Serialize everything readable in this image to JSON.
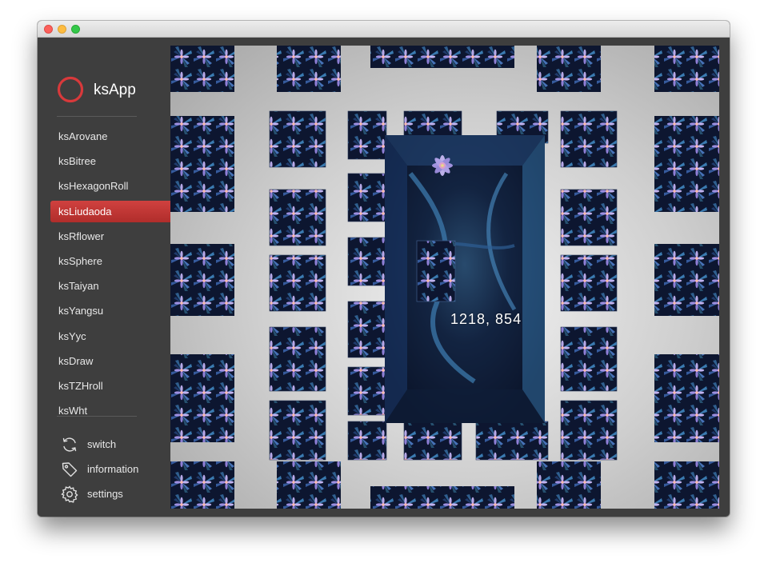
{
  "app": {
    "title": "ksApp",
    "accent_color": "#c7373a"
  },
  "window": {
    "controls": [
      "close",
      "minimize",
      "zoom"
    ]
  },
  "nav": {
    "items": [
      {
        "label": "ksArovane"
      },
      {
        "label": "ksBitree"
      },
      {
        "label": "ksHexagonRoll"
      },
      {
        "label": "ksLiudaoda",
        "active": true
      },
      {
        "label": "ksRflower"
      },
      {
        "label": "ksSphere"
      },
      {
        "label": "ksTaiyan"
      },
      {
        "label": "ksYangsu"
      },
      {
        "label": "ksYyc"
      },
      {
        "label": "ksDraw"
      },
      {
        "label": "ksTZHroll"
      },
      {
        "label": "ksWht"
      }
    ]
  },
  "footer": {
    "switch": {
      "label": "switch",
      "icon": "refresh-icon"
    },
    "information": {
      "label": "information",
      "icon": "tag-icon"
    },
    "settings": {
      "label": "settings",
      "icon": "gear-icon"
    }
  },
  "canvas": {
    "coordinates": "1218,  854"
  }
}
